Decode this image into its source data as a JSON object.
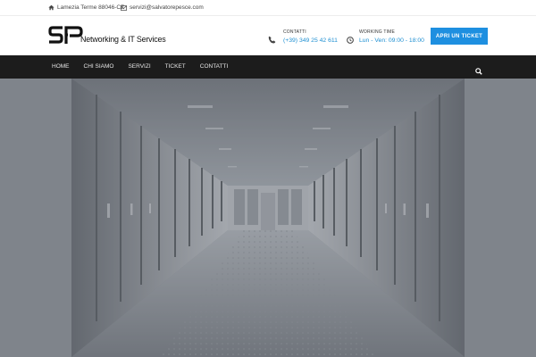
{
  "topbar": {
    "location": "Lamezia Terme 88046-CZ",
    "email": "servizi@salvatorepesce.com",
    "location_icon": "home-icon",
    "email_icon": "envelope-icon"
  },
  "header": {
    "logo_text": "Networking & IT Services",
    "contact": {
      "label": "CONTATTI",
      "value": "(+39) 349 25 42 611",
      "icon": "phone-icon"
    },
    "hours": {
      "label": "WORKING TIME",
      "value": "Lun - Ven: 09:00 - 18:00",
      "icon": "clock-icon"
    },
    "ticket_button": "APRI UN TICKET"
  },
  "nav": {
    "items": [
      {
        "label": "HOME"
      },
      {
        "label": "CHI SIAMO"
      },
      {
        "label": "SERVIZI"
      },
      {
        "label": "TICKET"
      },
      {
        "label": "CONTATTI"
      }
    ],
    "search_icon": "search-icon"
  },
  "colors": {
    "accent": "#1e8fe0",
    "nav_background": "#1c1c1c",
    "hero_overlay": "#7d8289"
  }
}
